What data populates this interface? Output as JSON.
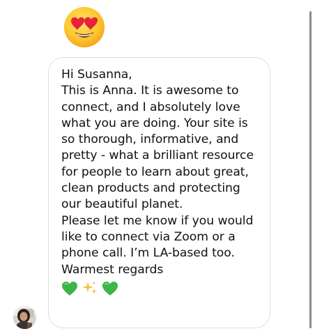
{
  "reaction": {
    "icon": "heart-eyes-emoji-icon"
  },
  "message": {
    "lines": [
      "Hi Susanna,",
      "This is Anna. It is awesome to",
      "connect, and I absolutely love",
      "what you are doing. Your site is",
      "so thorough, informative, and",
      "pretty - what a brilliant resource",
      "for people to learn about  great,",
      "clean products and protecting",
      "our beautiful planet.",
      "Please let me know if you would",
      "like to connect via Zoom or a",
      "phone call. I’m LA-based too.",
      "Warmest regards"
    ],
    "closing_emojis": [
      "green-heart-icon",
      "sparkles-icon",
      "green-heart-icon"
    ]
  },
  "sender": {
    "avatar_icon": "sender-avatar"
  },
  "colors": {
    "bubble_border": "#dcdcdc",
    "text": "#111111",
    "green_heart": "#3cb54a",
    "sparkles": "#f7c23b"
  }
}
